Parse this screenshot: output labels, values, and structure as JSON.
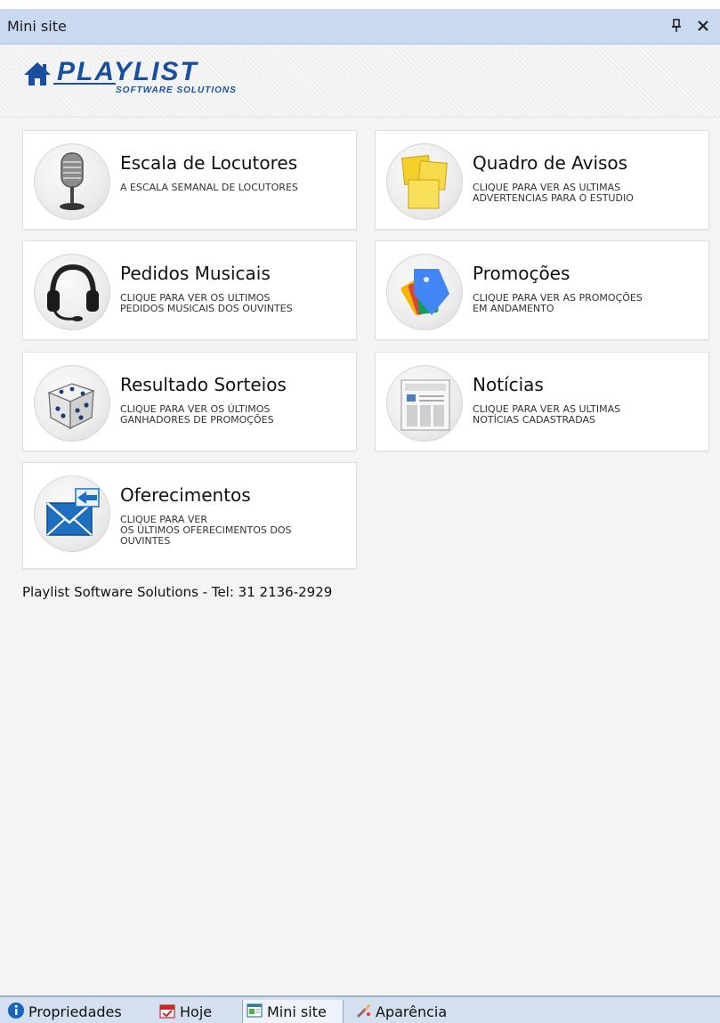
{
  "window": {
    "title": "Mini site",
    "pin_glyph": "Ρ",
    "close_glyph": "✕"
  },
  "logo": {
    "brand": "PLAYLIST",
    "tagline": "SOFTWARE SOLUTIONS",
    "icon": "home-icon"
  },
  "cards": [
    {
      "title": "Escala de Locutores",
      "description": "A ESCALA SEMANAL DE LOCUTORES",
      "icon": "microphone-icon"
    },
    {
      "title": "Quadro de Avisos",
      "description": " CLIQUE PARA VER AS ULTIMAS\nADVERTENCIAS PARA O ESTUDIO",
      "icon": "sticky-notes-icon"
    },
    {
      "title": "Pedidos Musicais",
      "description": "CLIQUE PARA VER OS ULTIMOS\nPEDIDOS MUSICAIS DOS OUVINTES",
      "icon": "headset-icon"
    },
    {
      "title": "Promoções",
      "description": "CLIQUE PARA VER AS PROMOÇÕES\nEM ANDAMENTO",
      "icon": "price-tags-icon"
    },
    {
      "title": "Resultado Sorteios",
      "description": "CLIQUE PARA VER OS ÚLTIMOS\nGANHADORES DE PROMOÇÕES",
      "icon": "dice-icon"
    },
    {
      "title": "Notícias",
      "description": "CLIQUE PARA VER AS ULTIMAS\nNOTÍCIAS CADASTRADAS",
      "icon": "newspaper-icon"
    },
    {
      "title": "Oferecimentos",
      "description": "CLIQUE PARA VER\nOS ÚLTIMOS OFERECIMENTOS DOS\nOUVINTES",
      "icon": "envelope-icon"
    }
  ],
  "footer": {
    "contact": "Playlist Software Solutions - Tel: 31 2136-2929"
  },
  "bottom_tabs": [
    {
      "label": "Propriedades",
      "icon": "info-icon",
      "active": false
    },
    {
      "label": "Hoje",
      "icon": "calendar-icon",
      "active": false
    },
    {
      "label": "Mini site",
      "icon": "web-page-icon",
      "active": true
    },
    {
      "label": "Aparência",
      "icon": "paint-brush-icon",
      "active": false
    }
  ],
  "colors": {
    "titlebar": "#c8d9f0",
    "logo_blue": "#1a4fa0",
    "bottombar": "#d4dff0"
  }
}
